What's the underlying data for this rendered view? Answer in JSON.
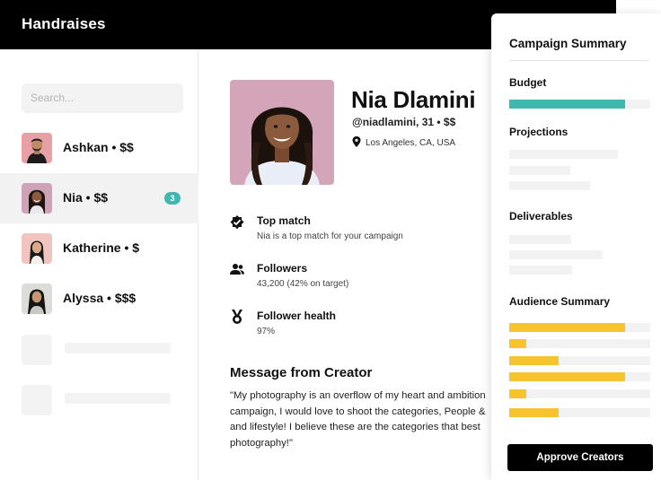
{
  "app": {
    "title": "Handraises"
  },
  "sidebar": {
    "search_placeholder": "Search...",
    "creators": [
      {
        "label": "Ashkan • $$",
        "active": false,
        "badge": ""
      },
      {
        "label": "Nia • $$",
        "active": true,
        "badge": "3"
      },
      {
        "label": "Katherine • $",
        "active": false,
        "badge": ""
      },
      {
        "label": "Alyssa • $$$",
        "active": false,
        "badge": ""
      }
    ]
  },
  "profile": {
    "name": "Nia Dlamini",
    "handle": "@niadlamini, 31 • $$",
    "location": "Los Angeles, CA, USA",
    "stats": [
      {
        "title": "Top match",
        "subtitle": "Nia is a top match for your campaign",
        "icon": "verified-badge-icon"
      },
      {
        "title": "Followers",
        "subtitle": "43,200 (42% on target)",
        "icon": "people-icon"
      },
      {
        "title": "Follower health",
        "subtitle": "97%",
        "icon": "medal-icon"
      }
    ],
    "message_title": "Message from Creator",
    "message_lines": [
      "\"My photography is an overflow of my heart and ambition",
      "campaign, I would love to shoot the categories, People &",
      "and lifestyle! I believe these are the categories that best",
      "photography!\""
    ]
  },
  "summary": {
    "title": "Campaign Summary",
    "budget_label": "Budget",
    "budget_fraction": 0.82,
    "projections_label": "Projections",
    "deliverables_label": "Deliverables",
    "audience_label": "Audience Summary",
    "audience_fractions": [
      0.82,
      0.12,
      0.35,
      0.82,
      0.12,
      0.35
    ],
    "approve_label": "Approve Creators"
  },
  "colors": {
    "accent_teal": "#3fb8b0",
    "audience_yellow": "#f7c32e",
    "topbar": "#000000"
  }
}
